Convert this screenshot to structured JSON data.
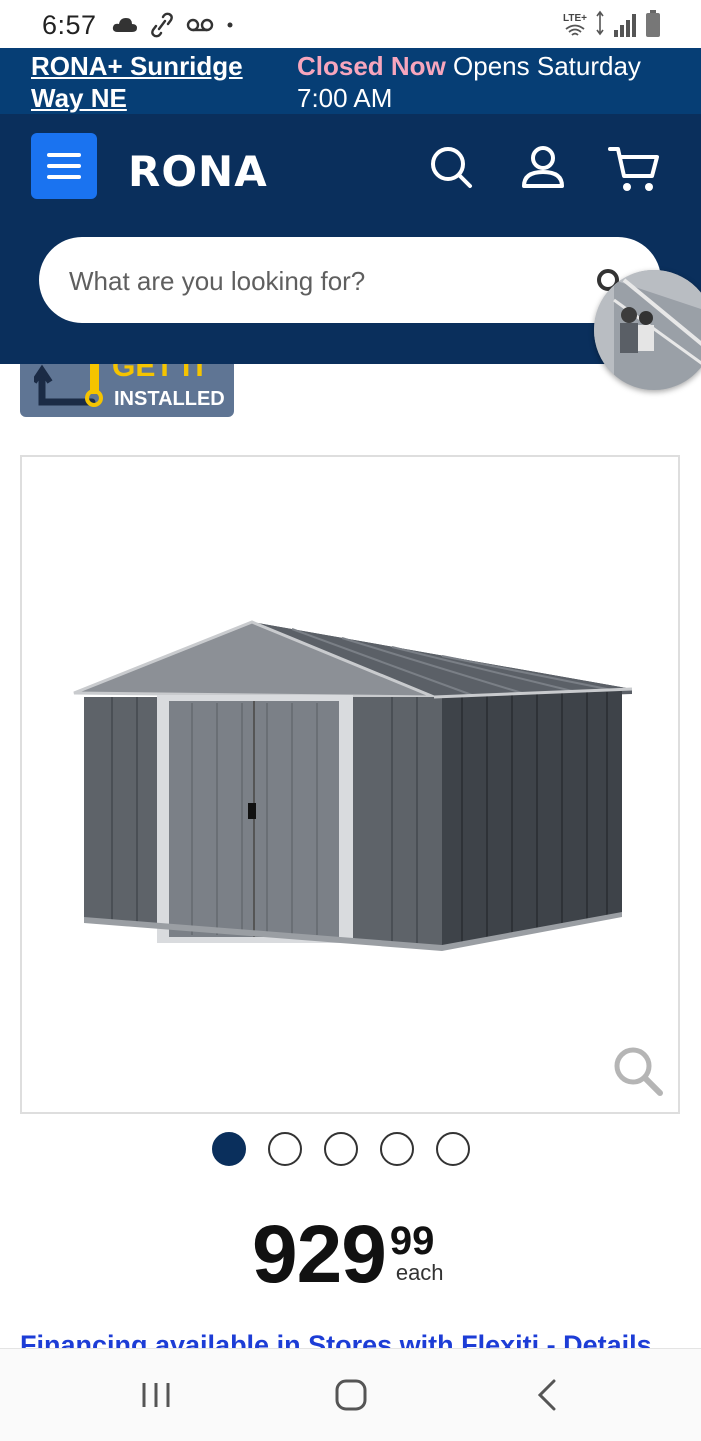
{
  "status_bar": {
    "time": "6:57",
    "network_label": "LTE+"
  },
  "store": {
    "name": "RONA+ Sunridge Way NE",
    "status_closed": "Closed Now",
    "status_opens": "Opens Saturday 7:00 AM"
  },
  "header": {
    "logo": "RONA",
    "search_placeholder": "What are you looking for?"
  },
  "badge": {
    "top": "GET IT",
    "label": "INSTALLED"
  },
  "gallery": {
    "image_count": 5,
    "active_index": 0
  },
  "price": {
    "dollars": "929",
    "cents": "99",
    "unit": "each"
  },
  "financing": {
    "text": "Financing available in Stores with Flexiti - Details"
  },
  "colors": {
    "brand_navy": "#0a2f5c",
    "store_bar": "#063e75",
    "menu_blue": "#1a73f0",
    "closed_pink": "#f7a6bd",
    "link_blue": "#1d3dd6"
  }
}
